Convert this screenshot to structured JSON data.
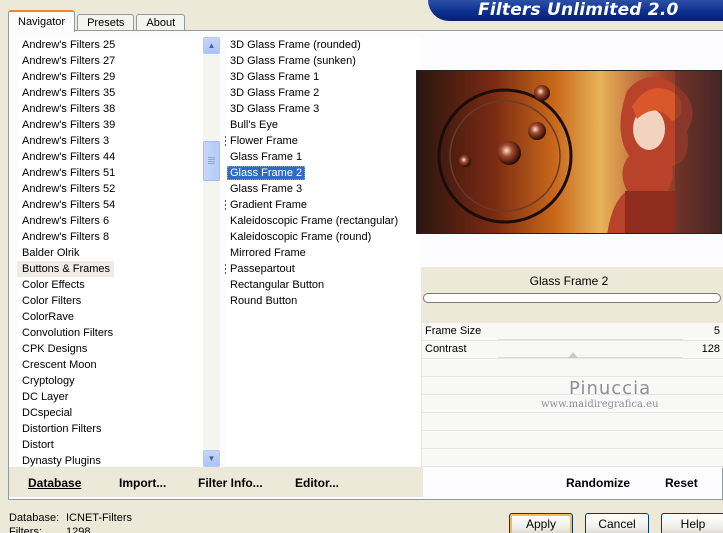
{
  "tabs": [
    "Navigator",
    "Presets",
    "About"
  ],
  "banner": {
    "title": "Filters Unlimited 2.0"
  },
  "categories": {
    "items": [
      "Andrew's Filters 25",
      "Andrew's Filters 27",
      "Andrew's Filters 29",
      "Andrew's Filters 35",
      "Andrew's Filters 38",
      "Andrew's Filters 39",
      "Andrew's Filters 3",
      "Andrew's Filters 44",
      "Andrew's Filters 51",
      "Andrew's Filters 52",
      "Andrew's Filters 54",
      "Andrew's Filters 6",
      "Andrew's Filters 8",
      "Balder Olrik",
      "Buttons & Frames",
      "Color Effects",
      "Color Filters",
      "ColorRave",
      "Convolution Filters",
      "CPK Designs",
      "Crescent Moon",
      "Cryptology",
      "DC Layer",
      "DCspecial",
      "Distortion Filters",
      "Distort",
      "Dynasty Plugins"
    ],
    "selected": "Buttons & Frames"
  },
  "filters": {
    "items": [
      "3D Glass Frame (rounded)",
      "3D Glass Frame (sunken)",
      "3D Glass Frame 1",
      "3D Glass Frame 2",
      "3D Glass Frame 3",
      "Bull's Eye",
      "Flower Frame",
      "Glass Frame 1",
      "Glass Frame 2",
      "Glass Frame 3",
      "Gradient Frame",
      "Kaleidoscopic Frame (rectangular)",
      "Kaleidoscopic Frame (round)",
      "Mirrored Frame",
      "Passepartout",
      "Rectangular Button",
      "Round Button"
    ],
    "marked": [
      "Flower Frame",
      "Gradient Frame",
      "Passepartout"
    ],
    "selected": "Glass Frame 2"
  },
  "panel_buttons": {
    "database": "Database",
    "import": "Import...",
    "filter_info": "Filter Info...",
    "editor": "Editor..."
  },
  "selected_filter_name": "Glass Frame 2",
  "params": [
    {
      "label": "Frame Size",
      "value": "5"
    },
    {
      "label": "Contrast",
      "value": "128"
    }
  ],
  "watermark": {
    "name": "Pinuccia",
    "url": "www.maidiregrafica.eu"
  },
  "right_buttons": {
    "randomize": "Randomize",
    "reset": "Reset"
  },
  "footer": {
    "database_label": "Database:",
    "database_value": "ICNET-Filters",
    "filters_label": "Filters:",
    "filters_value": "1298"
  },
  "dialog_buttons": {
    "apply": "Apply",
    "cancel": "Cancel",
    "help": "Help"
  }
}
